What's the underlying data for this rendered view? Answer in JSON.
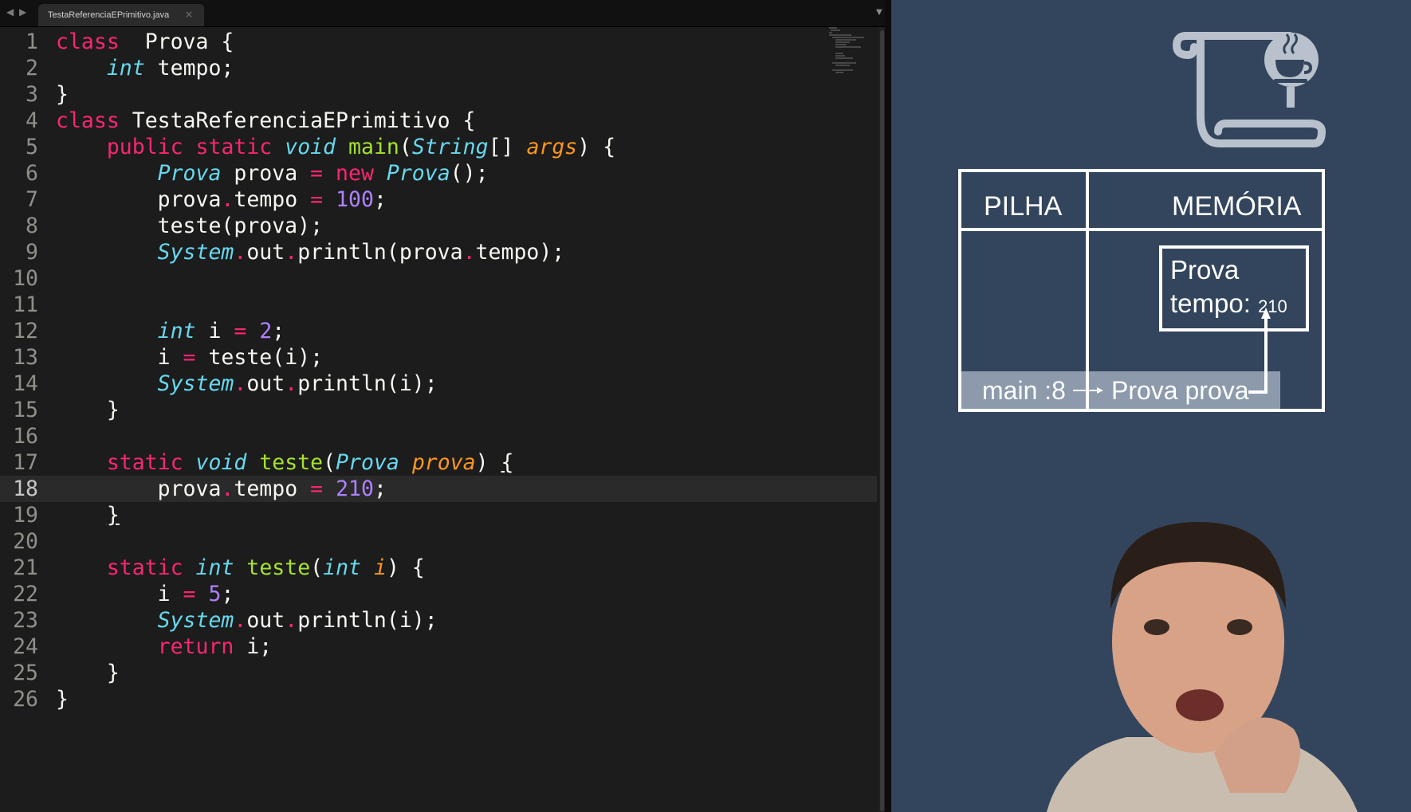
{
  "editor": {
    "tab_title": "TestaReferenciaEPrimitivo.java",
    "tab_close": "×",
    "nav_back": "◀",
    "nav_forward": "▶",
    "tab_dropdown": "▼",
    "current_line": 18,
    "lines": [
      {
        "n": "1",
        "t": [
          [
            "kw",
            "class"
          ],
          [
            "",
            "  Prova {"
          ]
        ]
      },
      {
        "n": "2",
        "t": [
          [
            "",
            "    "
          ],
          [
            "ty",
            "int"
          ],
          [
            "",
            " tempo;"
          ]
        ]
      },
      {
        "n": "3",
        "t": [
          [
            "",
            "}"
          ]
        ]
      },
      {
        "n": "4",
        "t": [
          [
            "kw",
            "class"
          ],
          [
            "",
            " TestaReferenciaEPrimitivo {"
          ]
        ]
      },
      {
        "n": "5",
        "t": [
          [
            "",
            "    "
          ],
          [
            "kw",
            "public"
          ],
          [
            "",
            " "
          ],
          [
            "kw",
            "static"
          ],
          [
            "",
            " "
          ],
          [
            "ty",
            "void"
          ],
          [
            "",
            " "
          ],
          [
            "fn",
            "main"
          ],
          [
            "",
            "("
          ],
          [
            "ty",
            "String"
          ],
          [
            "",
            "[] "
          ],
          [
            "pa",
            "args"
          ],
          [
            "",
            ") {"
          ]
        ]
      },
      {
        "n": "6",
        "t": [
          [
            "",
            "        "
          ],
          [
            "ty",
            "Prova"
          ],
          [
            "",
            " prova "
          ],
          [
            "op",
            "="
          ],
          [
            "",
            " "
          ],
          [
            "kw",
            "new"
          ],
          [
            "",
            " "
          ],
          [
            "ty",
            "Prova"
          ],
          [
            "",
            "();"
          ]
        ]
      },
      {
        "n": "7",
        "t": [
          [
            "",
            "        prova"
          ],
          [
            "op",
            "."
          ],
          [
            "",
            "tempo "
          ],
          [
            "op",
            "="
          ],
          [
            "",
            " "
          ],
          [
            "nm",
            "100"
          ],
          [
            "",
            ";"
          ]
        ]
      },
      {
        "n": "8",
        "t": [
          [
            "",
            "        teste(prova);"
          ]
        ]
      },
      {
        "n": "9",
        "t": [
          [
            "",
            "        "
          ],
          [
            "ty",
            "System"
          ],
          [
            "op",
            "."
          ],
          [
            "",
            "out"
          ],
          [
            "op",
            "."
          ],
          [
            "",
            "println(prova"
          ],
          [
            "op",
            "."
          ],
          [
            "",
            "tempo);"
          ]
        ]
      },
      {
        "n": "10",
        "t": []
      },
      {
        "n": "11",
        "t": []
      },
      {
        "n": "12",
        "t": [
          [
            "",
            "        "
          ],
          [
            "ty",
            "int"
          ],
          [
            "",
            " i "
          ],
          [
            "op",
            "="
          ],
          [
            "",
            " "
          ],
          [
            "nm",
            "2"
          ],
          [
            "",
            ";"
          ]
        ]
      },
      {
        "n": "13",
        "t": [
          [
            "",
            "        i "
          ],
          [
            "op",
            "="
          ],
          [
            "",
            " teste(i);"
          ]
        ]
      },
      {
        "n": "14",
        "t": [
          [
            "",
            "        "
          ],
          [
            "ty",
            "System"
          ],
          [
            "op",
            "."
          ],
          [
            "",
            "out"
          ],
          [
            "op",
            "."
          ],
          [
            "",
            "println(i);"
          ]
        ]
      },
      {
        "n": "15",
        "t": [
          [
            "",
            "    }"
          ]
        ]
      },
      {
        "n": "16",
        "t": []
      },
      {
        "n": "17",
        "t": [
          [
            "",
            "    "
          ],
          [
            "kw",
            "static"
          ],
          [
            "",
            " "
          ],
          [
            "ty",
            "void"
          ],
          [
            "",
            " "
          ],
          [
            "fn",
            "teste"
          ],
          [
            "",
            "("
          ],
          [
            "ty",
            "Prova"
          ],
          [
            "",
            " "
          ],
          [
            "pa",
            "prova"
          ],
          [
            "",
            ") "
          ],
          [
            "ul",
            "{"
          ]
        ]
      },
      {
        "n": "18",
        "t": [
          [
            "",
            "        prova"
          ],
          [
            "op",
            "."
          ],
          [
            "",
            "tempo "
          ],
          [
            "op",
            "="
          ],
          [
            "",
            " "
          ],
          [
            "nm",
            "210"
          ],
          [
            "",
            ";"
          ]
        ]
      },
      {
        "n": "19",
        "t": [
          [
            "",
            "    "
          ],
          [
            "ul",
            "}"
          ]
        ]
      },
      {
        "n": "20",
        "t": []
      },
      {
        "n": "21",
        "t": [
          [
            "",
            "    "
          ],
          [
            "kw",
            "static"
          ],
          [
            "",
            " "
          ],
          [
            "ty",
            "int"
          ],
          [
            "",
            " "
          ],
          [
            "fn",
            "teste"
          ],
          [
            "",
            "("
          ],
          [
            "ty",
            "int"
          ],
          [
            "",
            " "
          ],
          [
            "pa",
            "i"
          ],
          [
            "",
            ") {"
          ]
        ]
      },
      {
        "n": "22",
        "t": [
          [
            "",
            "        i "
          ],
          [
            "op",
            "="
          ],
          [
            "",
            " "
          ],
          [
            "nm",
            "5"
          ],
          [
            "",
            ";"
          ]
        ]
      },
      {
        "n": "23",
        "t": [
          [
            "",
            "        "
          ],
          [
            "ty",
            "System"
          ],
          [
            "op",
            "."
          ],
          [
            "",
            "out"
          ],
          [
            "op",
            "."
          ],
          [
            "",
            "println(i);"
          ]
        ]
      },
      {
        "n": "24",
        "t": [
          [
            "",
            "        "
          ],
          [
            "kw",
            "return"
          ],
          [
            "",
            " i;"
          ]
        ]
      },
      {
        "n": "25",
        "t": [
          [
            "",
            "    }"
          ]
        ]
      },
      {
        "n": "26",
        "t": [
          [
            "",
            "}"
          ]
        ]
      }
    ]
  },
  "diagram": {
    "stack_header": "PILHA",
    "memory_header": "MEMÓRIA",
    "stack_frame": "main :8",
    "stack_variable": "Prova prova",
    "object_class": "Prova",
    "object_field": "tempo:",
    "object_field_value": "210"
  },
  "colors": {
    "panel_bg": "#33455d",
    "frame_highlight": "#8c9aac",
    "keyword": "#f92672",
    "type": "#66d9ef",
    "function": "#a6e22e",
    "number": "#ae81ff",
    "param": "#fd971f"
  },
  "icons": {
    "logo": "scroll-coffee-icon"
  }
}
